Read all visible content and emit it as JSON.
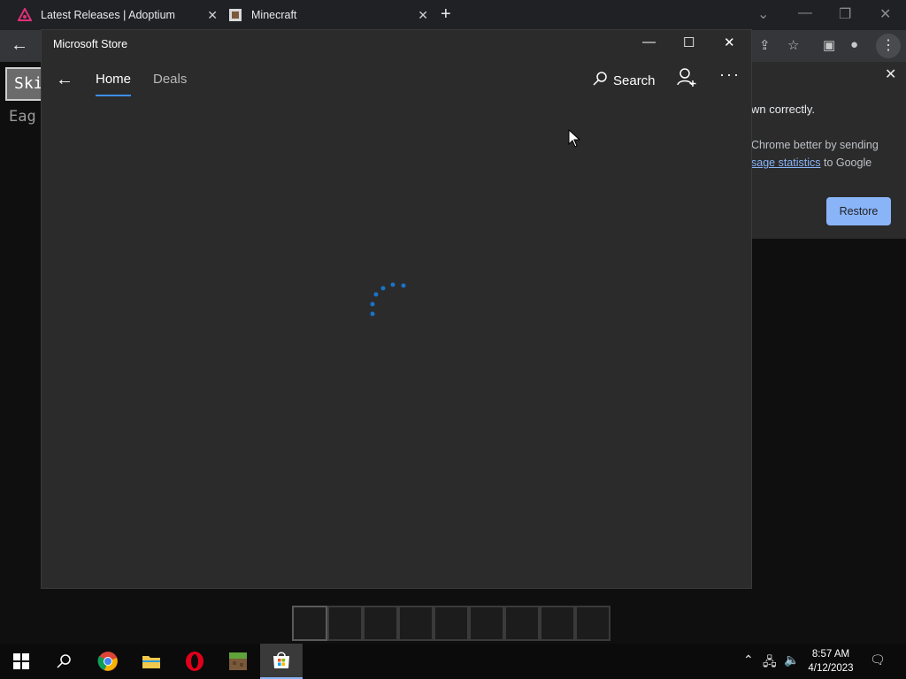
{
  "browser": {
    "tabs": [
      {
        "label": "Latest Releases | Adoptium",
        "icon": "adoptium-icon"
      },
      {
        "label": "Minecraft",
        "icon": "minecraft-favicon-icon"
      }
    ],
    "new_tab": "+",
    "window_controls": [
      "chevron-down-icon",
      "minimize-icon",
      "restore-icon",
      "close-icon"
    ]
  },
  "minecraft_page": {
    "button_label": "Ski",
    "text": "Eag",
    "hotbar_slots": 9
  },
  "infobar": {
    "title": "wn correctly.",
    "line1": "Chrome better by sending",
    "link": "sage statistics",
    "line2_suffix": " to Google",
    "restore_label": "Restore"
  },
  "store": {
    "title": "Microsoft Store",
    "nav": {
      "home": "Home",
      "deals": "Deals",
      "search": "Search"
    }
  },
  "taskbar": {
    "time": "8:57 AM",
    "date": "4/12/2023"
  },
  "colors": {
    "accent": "#3b8ee8",
    "link": "#8ab4f8",
    "store_bg": "#2b2b2b"
  }
}
